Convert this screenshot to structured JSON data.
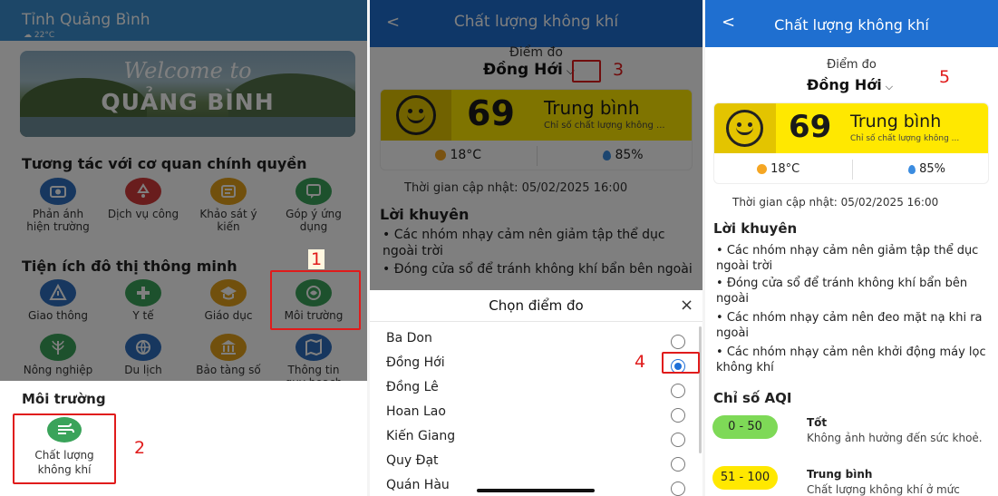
{
  "panel1": {
    "header": {
      "city": "Tỉnh Quảng Bình",
      "weather": "22°C"
    },
    "banner": {
      "line1": "Welcome to",
      "line2": "QUẢNG BÌNH"
    },
    "section1": {
      "title": "Tương tác với cơ quan chính quyền",
      "items": [
        {
          "label": "Phản ánh hiện trường",
          "icon": "camera-icon"
        },
        {
          "label": "Dịch vụ công",
          "icon": "recycle-icon"
        },
        {
          "label": "Khảo sát ý kiến",
          "icon": "survey-icon"
        },
        {
          "label": "Góp ý ứng dụng",
          "icon": "feedback-icon"
        }
      ]
    },
    "section2": {
      "title": "Tiện ích đô thị thông minh",
      "items": [
        {
          "label": "Giao thông",
          "icon": "traffic-icon"
        },
        {
          "label": "Y tế",
          "icon": "health-icon"
        },
        {
          "label": "Giáo dục",
          "icon": "education-icon"
        },
        {
          "label": "Môi trường",
          "icon": "environment-icon"
        }
      ],
      "items_row2": [
        {
          "label": "Nông nghiệp",
          "icon": "agriculture-icon"
        },
        {
          "label": "Du lịch",
          "icon": "travel-icon"
        },
        {
          "label": "Bảo tàng số",
          "icon": "museum-icon"
        },
        {
          "label": "Thông tin quy hoạch",
          "icon": "planning-icon"
        }
      ]
    },
    "sheet": {
      "title": "Môi trường",
      "item": "Chất lượng không khí"
    },
    "markers": {
      "m1": "1",
      "m2": "2"
    }
  },
  "panel2": {
    "nav": {
      "back": "<",
      "title": "Chất lượng không khí"
    },
    "station": {
      "label": "Điểm đo",
      "value": "Đồng Hới"
    },
    "aqi": {
      "value": "69",
      "level": "Trung bình",
      "desc": "Chỉ số chất lượng không ..."
    },
    "temp": "18°C",
    "humidity": "85%",
    "updated": "Thời gian cập nhật: 05/02/2025 16:00",
    "advice": {
      "title": "Lời khuyên",
      "items": [
        "Các nhóm nhạy cảm nên giảm tập thể dục ngoài trời",
        "Đóng cửa sổ để tránh không khí bẩn bên ngoài"
      ]
    },
    "picker": {
      "title": "Chọn điểm đo",
      "close": "×",
      "options": [
        "Ba Don",
        "Đồng Hới",
        "Đồng Lê",
        "Hoan Lao",
        "Kiến Giang",
        "Quy Đạt",
        "Quán Hàu"
      ],
      "selected": "Đồng Hới"
    },
    "markers": {
      "m3": "3",
      "m4": "4"
    }
  },
  "panel3": {
    "nav": {
      "back": "<",
      "title": "Chất lượng không khí"
    },
    "station": {
      "label": "Điểm đo",
      "value": "Đồng Hới"
    },
    "aqi": {
      "value": "69",
      "level": "Trung bình",
      "desc": "Chỉ số chất lượng không ..."
    },
    "temp": "18°C",
    "humidity": "85%",
    "updated": "Thời gian cập nhật: 05/02/2025 16:00",
    "advice": {
      "title": "Lời khuyên",
      "items": [
        "Các nhóm nhạy cảm nên giảm tập thể dục ngoài trời",
        "Đóng cửa sổ để tránh không khí bẩn bên ngoài",
        "Các nhóm nhạy cảm nên đeo mặt nạ khi ra ngoài",
        "Các nhóm nhạy cảm nên khởi động máy lọc không khí"
      ]
    },
    "aqi_index": {
      "title": "Chỉ số AQI",
      "levels": [
        {
          "range": "0 - 50",
          "name": "Tốt",
          "desc": "Không ảnh hưởng đến sức khoẻ.",
          "color": "#7ed957"
        },
        {
          "range": "51 - 100",
          "name": "Trung bình",
          "desc": "Chất lượng không khí ở mức",
          "color": "#ffe800"
        }
      ]
    },
    "markers": {
      "m5": "5"
    }
  },
  "colors": {
    "header_blue": "#3a8fd0",
    "nav_blue": "#1f6fd0",
    "aqi_yellow": "#ffe800",
    "marker_red": "#e01b1b"
  }
}
